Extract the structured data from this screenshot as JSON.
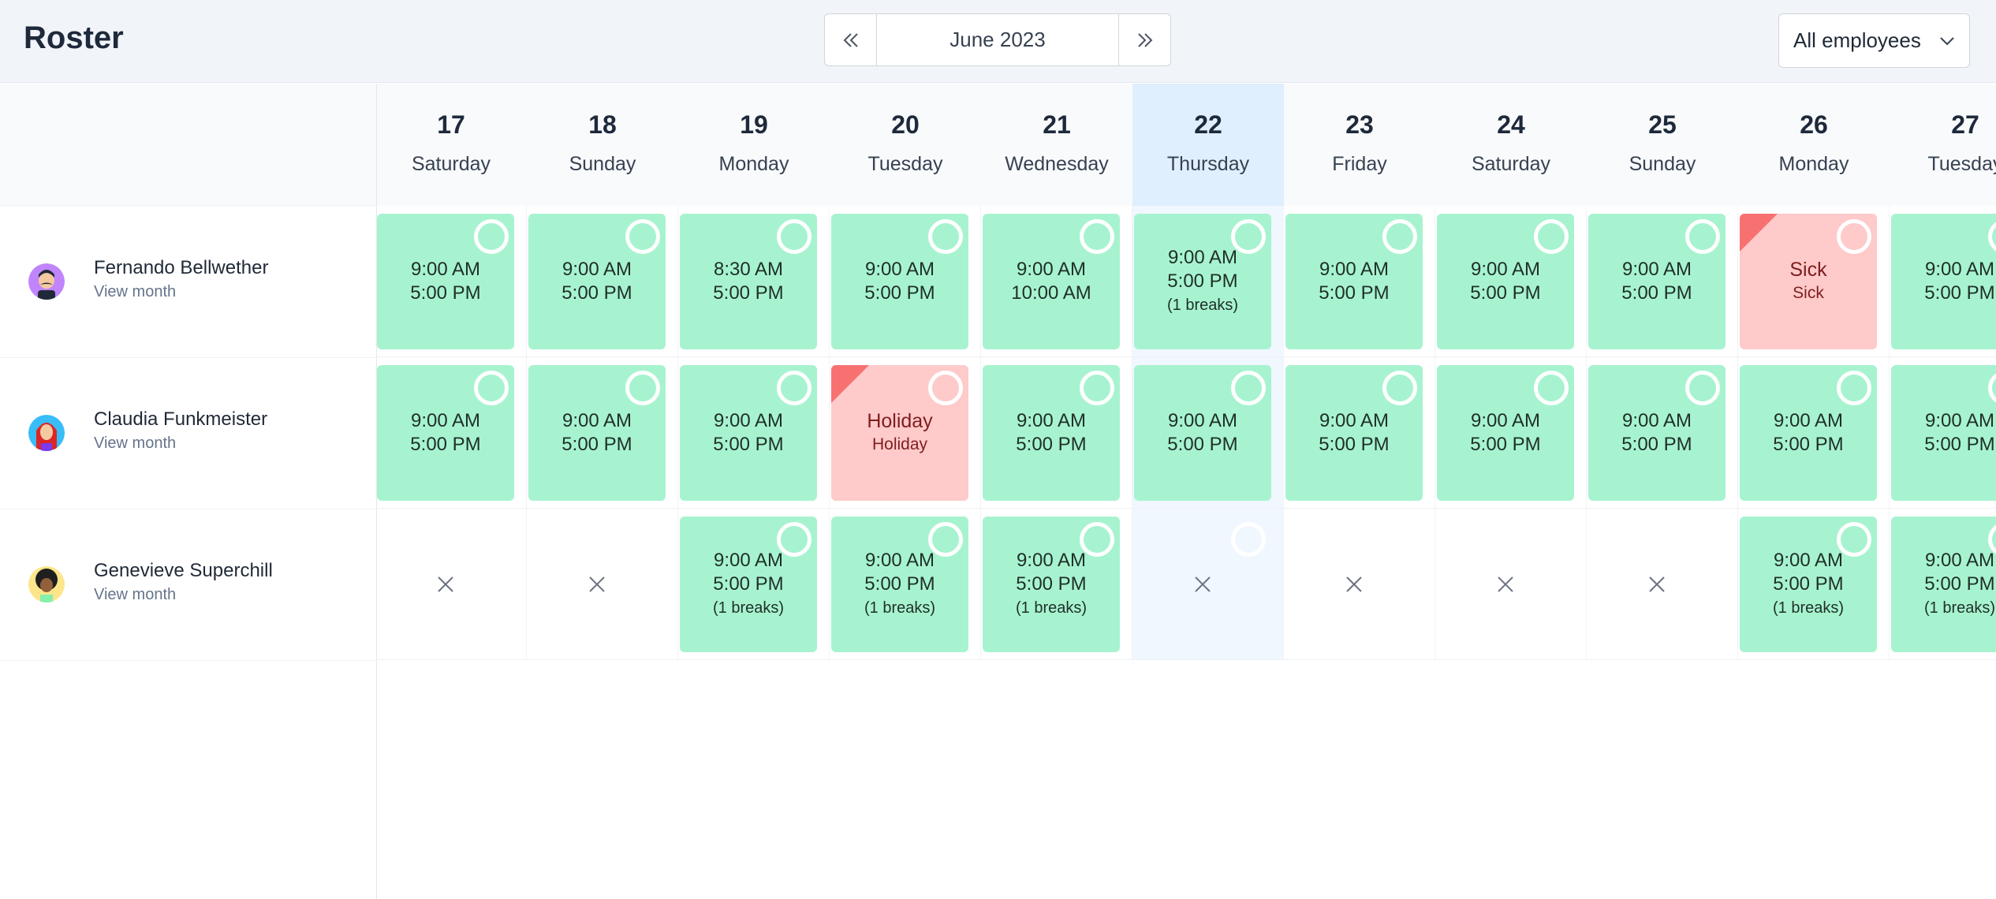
{
  "header": {
    "title": "Roster",
    "month": "June 2023",
    "filter": "All employees"
  },
  "days": [
    {
      "num": "17",
      "name": "Saturday"
    },
    {
      "num": "18",
      "name": "Sunday"
    },
    {
      "num": "19",
      "name": "Monday"
    },
    {
      "num": "20",
      "name": "Tuesday"
    },
    {
      "num": "21",
      "name": "Wednesday"
    },
    {
      "num": "22",
      "name": "Thursday",
      "today": true
    },
    {
      "num": "23",
      "name": "Friday"
    },
    {
      "num": "24",
      "name": "Saturday"
    },
    {
      "num": "25",
      "name": "Sunday"
    },
    {
      "num": "26",
      "name": "Monday"
    },
    {
      "num": "27",
      "name": "Tuesday"
    }
  ],
  "employees": [
    {
      "name": "Fernando Bellwether",
      "link": "View month",
      "avatar": "mustache-man-avatar",
      "cells": [
        {
          "type": "shift",
          "lines": [
            "9:00 AM",
            "5:00 PM"
          ]
        },
        {
          "type": "shift",
          "lines": [
            "9:00 AM",
            "5:00 PM"
          ]
        },
        {
          "type": "shift",
          "lines": [
            "8:30 AM",
            "5:00 PM"
          ]
        },
        {
          "type": "shift",
          "lines": [
            "9:00 AM",
            "5:00 PM"
          ]
        },
        {
          "type": "shift",
          "lines": [
            "9:00 AM",
            "10:00 AM"
          ]
        },
        {
          "type": "shift",
          "lines": [
            "9:00 AM",
            "5:00 PM",
            "(1 breaks)"
          ]
        },
        {
          "type": "shift",
          "lines": [
            "9:00 AM",
            "5:00 PM"
          ]
        },
        {
          "type": "shift",
          "lines": [
            "9:00 AM",
            "5:00 PM"
          ]
        },
        {
          "type": "shift",
          "lines": [
            "9:00 AM",
            "5:00 PM"
          ]
        },
        {
          "type": "absence",
          "lines": [
            "Sick",
            "Sick"
          ]
        },
        {
          "type": "shift",
          "lines": [
            "9:00 AM",
            "5:00 PM"
          ]
        }
      ]
    },
    {
      "name": "Claudia Funkmeister",
      "link": "View month",
      "avatar": "red-hair-woman-avatar",
      "cells": [
        {
          "type": "shift",
          "lines": [
            "9:00 AM",
            "5:00 PM"
          ]
        },
        {
          "type": "shift",
          "lines": [
            "9:00 AM",
            "5:00 PM"
          ]
        },
        {
          "type": "shift",
          "lines": [
            "9:00 AM",
            "5:00 PM"
          ]
        },
        {
          "type": "absence",
          "lines": [
            "Holiday",
            "Holiday"
          ]
        },
        {
          "type": "shift",
          "lines": [
            "9:00 AM",
            "5:00 PM"
          ]
        },
        {
          "type": "shift",
          "lines": [
            "9:00 AM",
            "5:00 PM"
          ]
        },
        {
          "type": "shift",
          "lines": [
            "9:00 AM",
            "5:00 PM"
          ]
        },
        {
          "type": "shift",
          "lines": [
            "9:00 AM",
            "5:00 PM"
          ]
        },
        {
          "type": "shift",
          "lines": [
            "9:00 AM",
            "5:00 PM"
          ]
        },
        {
          "type": "shift",
          "lines": [
            "9:00 AM",
            "5:00 PM"
          ]
        },
        {
          "type": "shift",
          "lines": [
            "9:00 AM",
            "5:00 PM"
          ]
        }
      ]
    },
    {
      "name": "Genevieve Superchill",
      "link": "View month",
      "avatar": "afro-woman-avatar",
      "cells": [
        {
          "type": "off"
        },
        {
          "type": "off"
        },
        {
          "type": "shift",
          "lines": [
            "9:00 AM",
            "5:00 PM",
            "(1 breaks)"
          ]
        },
        {
          "type": "shift",
          "lines": [
            "9:00 AM",
            "5:00 PM",
            "(1 breaks)"
          ]
        },
        {
          "type": "shift",
          "lines": [
            "9:00 AM",
            "5:00 PM",
            "(1 breaks)"
          ]
        },
        {
          "type": "off",
          "ring": true
        },
        {
          "type": "off"
        },
        {
          "type": "off"
        },
        {
          "type": "off"
        },
        {
          "type": "shift",
          "lines": [
            "9:00 AM",
            "5:00 PM",
            "(1 breaks)"
          ]
        },
        {
          "type": "shift",
          "lines": [
            "9:00 AM",
            "5:00 PM",
            "(1 breaks)"
          ]
        }
      ]
    }
  ],
  "colors": {
    "shift": "#a7f3d0",
    "absence": "#fecaca",
    "absence_corner": "#f87171",
    "today": "#dfeffd"
  }
}
